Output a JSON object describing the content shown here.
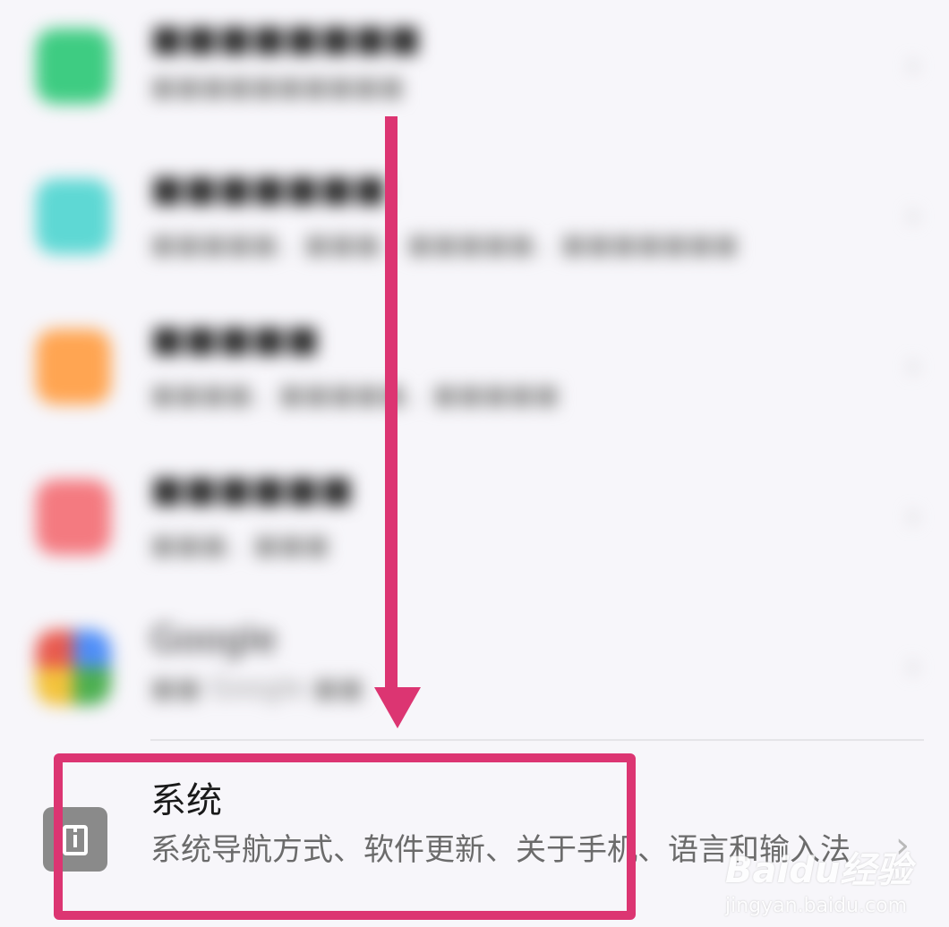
{
  "blurred_items": [
    {
      "title": "■■■■■■■■",
      "subtitle": "■■■■■■■■■■",
      "icon": "blurred-app-icon",
      "color": "#3ecc82"
    },
    {
      "title": "■■■■■■■",
      "subtitle": "■■■■■、■■■、■■■■■、■■■■■■■",
      "icon": "blurred-app-icon",
      "color": "#5ed8d4"
    },
    {
      "title": "■■■■■",
      "subtitle": "■■■■、■■■■■、■■■■■",
      "icon": "blurred-app-icon",
      "color": "#ffa552"
    },
    {
      "title": "■■■■■■",
      "subtitle": "■■■、■■■",
      "icon": "blurred-app-icon",
      "color": "#f47a80"
    },
    {
      "title": "Google",
      "subtitle": "■■ Google ■■",
      "icon": "google-icon",
      "color": "#4f8ef7"
    }
  ],
  "system_item": {
    "title": "系统",
    "subtitle": "系统导航方式、软件更新、关于手机、语言和输入法",
    "icon": "phone-info-icon"
  },
  "watermark": {
    "logo": "Baidu经验",
    "url": "jingyan.baidu.com"
  },
  "annotation_color": "#dc3572"
}
